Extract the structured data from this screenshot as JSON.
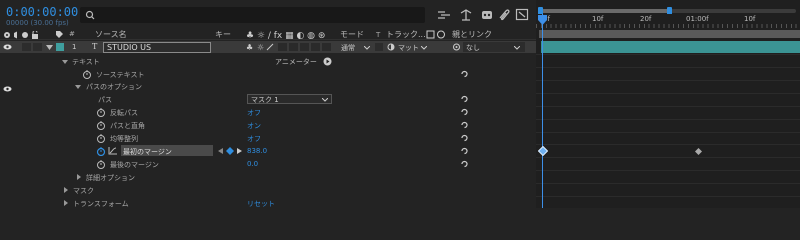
{
  "header": {
    "timecode": "0:00:00:00",
    "frame_info": "00000 (30.00 fps)",
    "search_placeholder": ""
  },
  "columns": {
    "index": "#",
    "source_name": "ソース名",
    "key": "キー",
    "mode": "モード",
    "t": "T",
    "track": "トラック...",
    "parent": "親とリンク"
  },
  "layer": {
    "index": "1",
    "type_glyph": "T",
    "name": "STUDIO US",
    "mode": "通常",
    "track": "マット",
    "parent": "なし"
  },
  "tree": {
    "text_group": "テキスト",
    "animator_label": "アニメーター",
    "source_text": "ソーステキスト",
    "path_options": "パスのオプション",
    "path_label": "パス",
    "path_value": "マスク 1",
    "reverse_path": "反転パス",
    "reverse_path_value": "オフ",
    "perpendicular": "パスと直角",
    "perpendicular_value": "オン",
    "force_align": "均等整列",
    "force_align_value": "オフ",
    "first_margin": "最初のマージン",
    "first_margin_value": "838.0",
    "last_margin": "最後のマージン",
    "last_margin_value": "0.0",
    "more_options": "詳細オプション",
    "masks": "マスク",
    "transform": "トランスフォーム",
    "reset": "リセット"
  },
  "timeline": {
    "ruler_labels": [
      "0f",
      "10f",
      "20f",
      "01:00f",
      "10f"
    ]
  },
  "colors": {
    "accent_blue": "#2f8ee0",
    "layer_bar": "#3b9494",
    "layer_label": "#3f9f9f",
    "playhead": "#3d8fe8"
  }
}
